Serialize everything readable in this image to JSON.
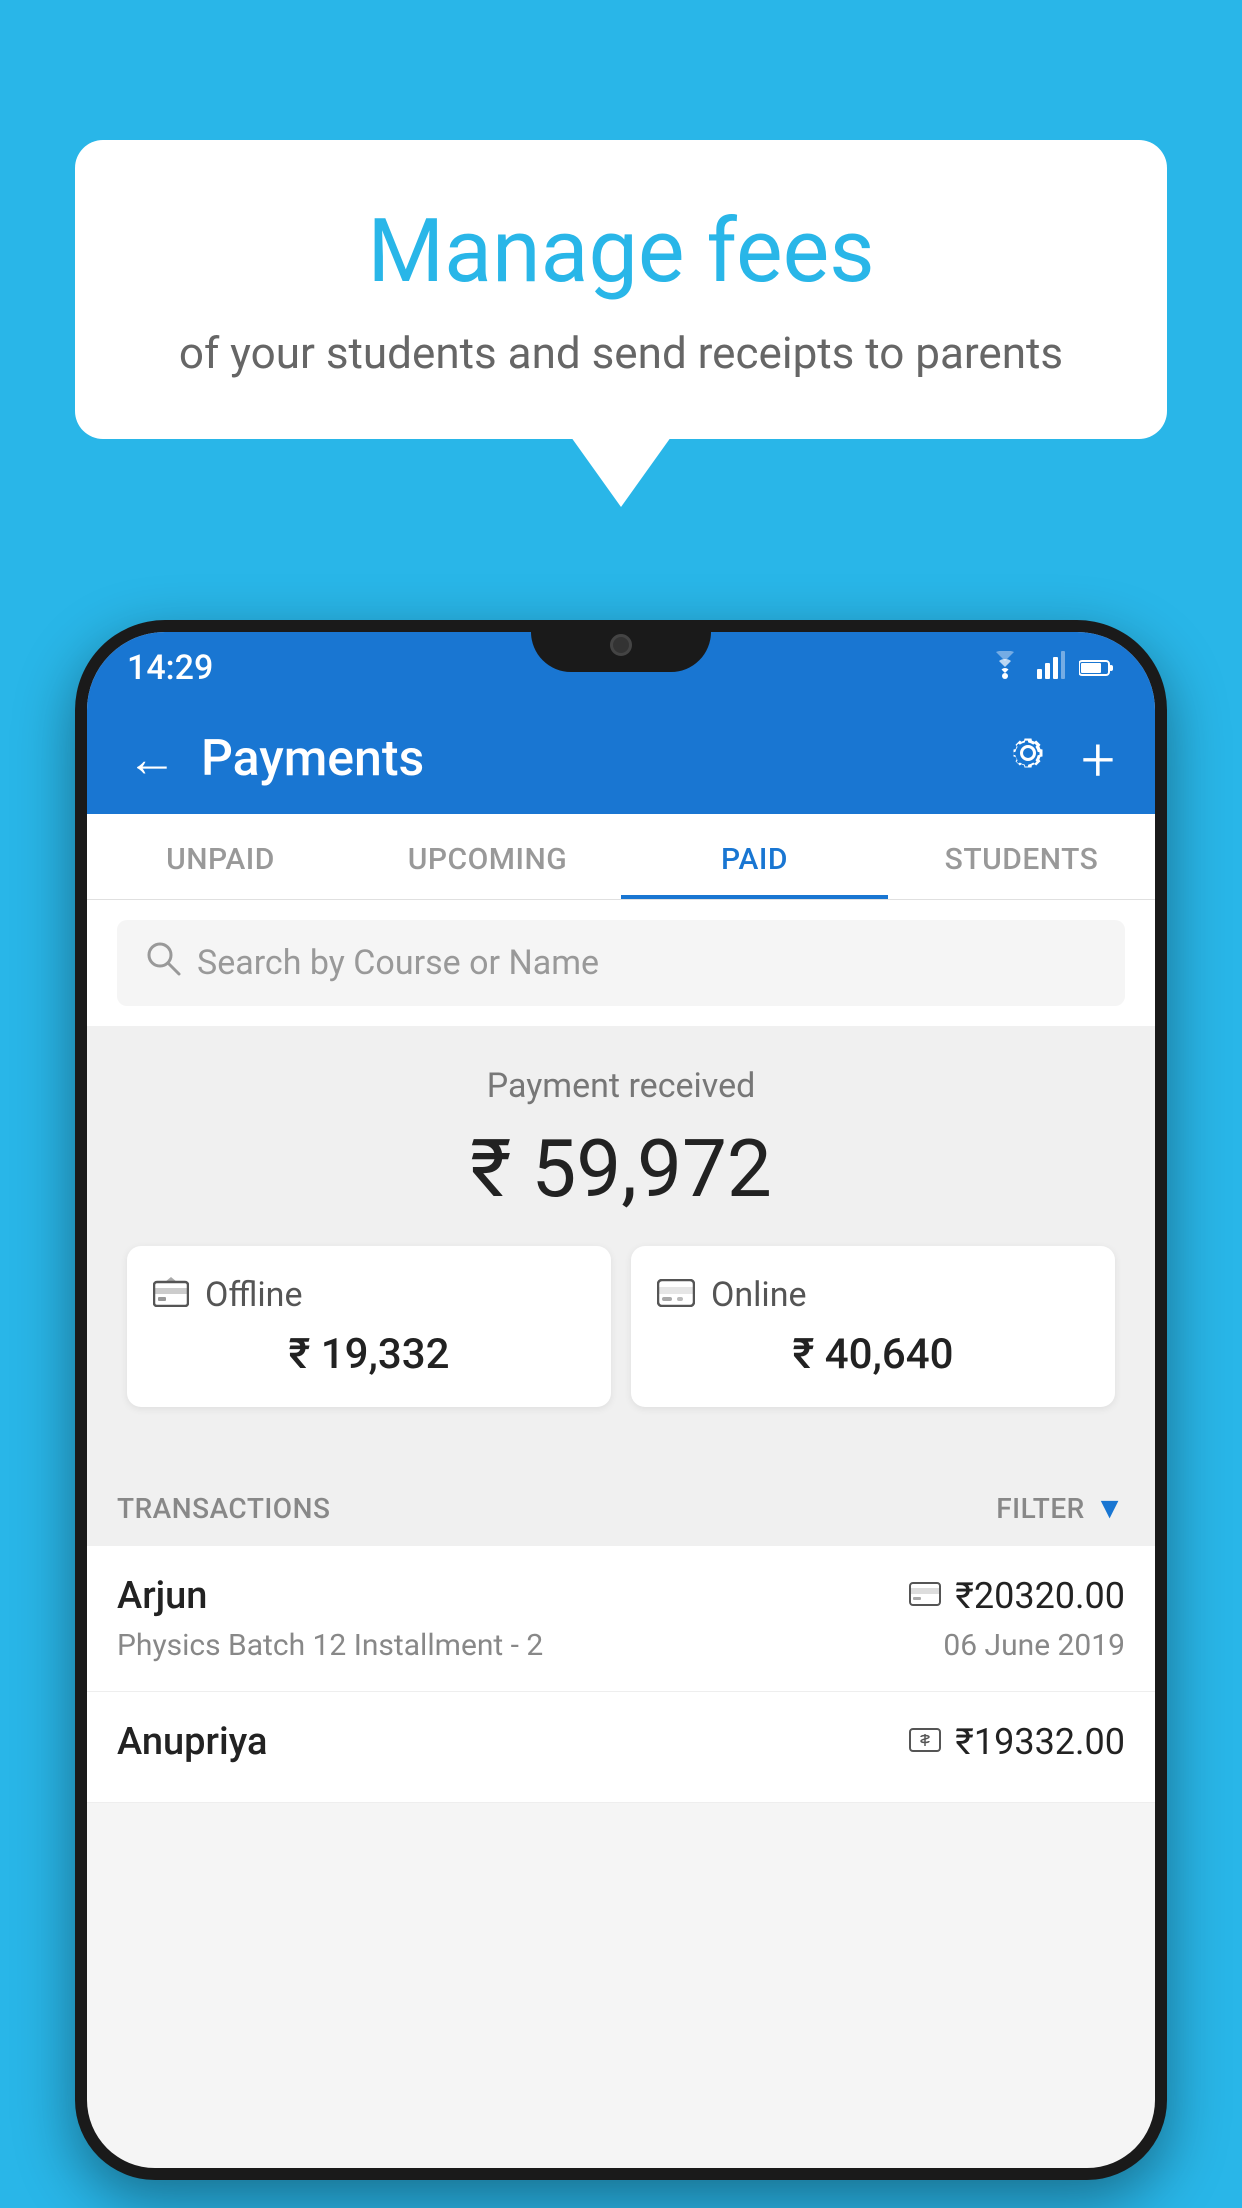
{
  "background_color": "#29B6E8",
  "speech_bubble": {
    "title": "Manage fees",
    "subtitle": "of your students and send receipts to parents"
  },
  "status_bar": {
    "time": "14:29",
    "icons": [
      "wifi",
      "signal",
      "battery"
    ]
  },
  "header": {
    "title": "Payments",
    "back_icon": "←",
    "gear_icon": "⚙",
    "plus_icon": "+"
  },
  "tabs": [
    {
      "label": "UNPAID",
      "active": false
    },
    {
      "label": "UPCOMING",
      "active": false
    },
    {
      "label": "PAID",
      "active": true
    },
    {
      "label": "STUDENTS",
      "active": false
    }
  ],
  "search": {
    "placeholder": "Search by Course or Name"
  },
  "payment_summary": {
    "label": "Payment received",
    "amount": "₹ 59,972",
    "offline": {
      "label": "Offline",
      "amount": "₹ 19,332"
    },
    "online": {
      "label": "Online",
      "amount": "₹ 40,640"
    }
  },
  "transactions": {
    "section_label": "TRANSACTIONS",
    "filter_label": "FILTER",
    "rows": [
      {
        "name": "Arjun",
        "payment_icon": "card",
        "amount": "₹20320.00",
        "course": "Physics Batch 12 Installment - 2",
        "date": "06 June 2019"
      },
      {
        "name": "Anupriya",
        "payment_icon": "cash",
        "amount": "₹19332.00",
        "course": "",
        "date": ""
      }
    ]
  }
}
